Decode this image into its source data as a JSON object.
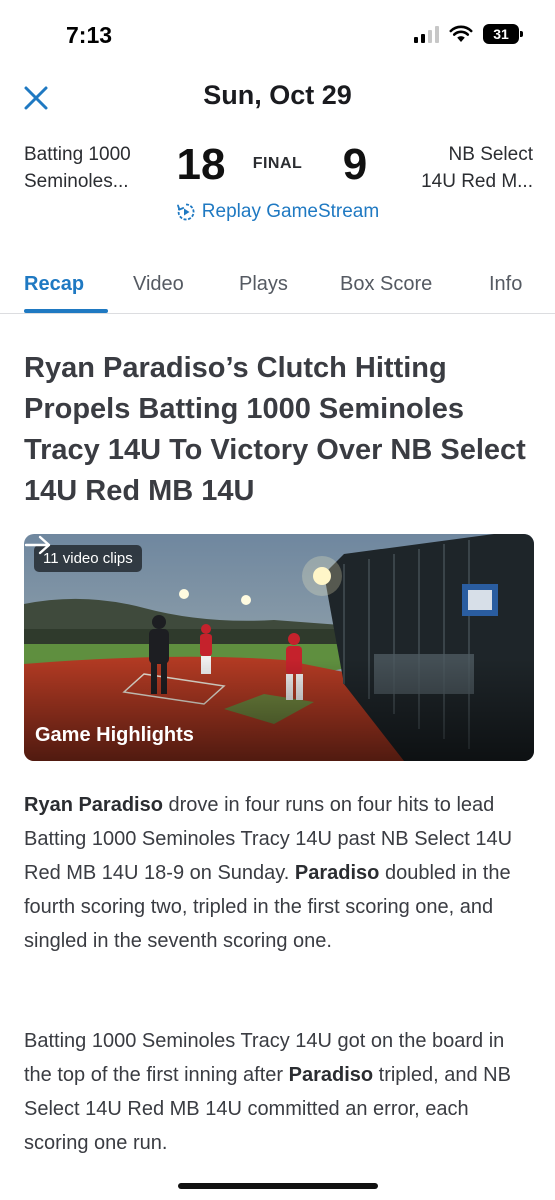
{
  "status_bar": {
    "time": "7:13",
    "battery": "31"
  },
  "header": {
    "title": "Sun, Oct 29"
  },
  "game": {
    "home_team_line1": "Batting 1000",
    "home_team_line2": "Seminoles...",
    "home_score": "18",
    "status": "FINAL",
    "away_score": "9",
    "away_team_line1": "NB Select",
    "away_team_line2": "14U Red M...",
    "replay_label": "Replay GameStream"
  },
  "tabs": [
    {
      "label": "Recap",
      "active": true
    },
    {
      "label": "Video",
      "active": false
    },
    {
      "label": "Plays",
      "active": false
    },
    {
      "label": "Box Score",
      "active": false
    },
    {
      "label": "Info",
      "active": false
    }
  ],
  "article": {
    "headline": "Ryan Paradiso’s Clutch Hitting Propels Batting 1000 Seminoles Tracy 14U To Victory Over NB Select 14U Red MB 14U",
    "video": {
      "clips_badge": "11 video clips",
      "label": "Game Highlights"
    },
    "p1": {
      "s1_bold": "Ryan Paradiso",
      "s1_text": " drove in four runs on four hits to lead Batting 1000 Seminoles Tracy 14U past NB Select 14U Red MB 14U 18-9 on Sunday. ",
      "s2_bold": "Paradiso",
      "s2_text": " doubled in the fourth scoring two, tripled in the first scoring one, and singled in the seventh scoring one."
    },
    "p2": {
      "s1_text": "Batting 1000 Seminoles Tracy 14U got on the board in the top of the first inning after ",
      "s2_bold": "Paradiso",
      "s2_text": " tripled, and NB Select 14U Red MB 14U committed an error, each scoring one run."
    }
  },
  "colors": {
    "accent": "#1f79c2",
    "text": "#3a3c42"
  }
}
